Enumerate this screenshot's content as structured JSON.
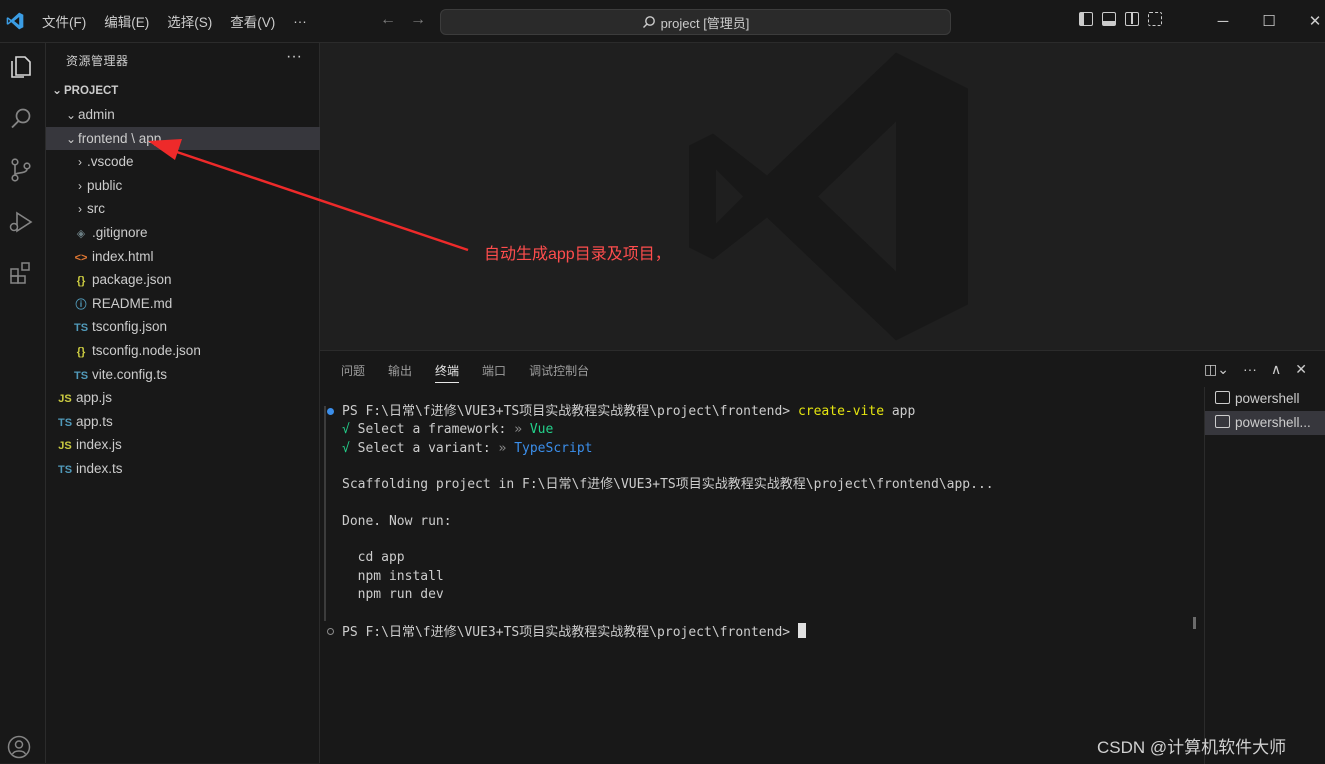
{
  "menu": {
    "items": [
      "文件(F)",
      "编辑(E)",
      "选择(S)",
      "查看(V)",
      "···"
    ]
  },
  "command_center": {
    "text": "project [管理员]"
  },
  "explorer": {
    "title": "资源管理器",
    "more": "···",
    "project_label": "PROJECT",
    "tree": [
      {
        "label": "admin",
        "kind": "folder-open",
        "icon": ""
      },
      {
        "label": "frontend \\ app",
        "kind": "folder-open",
        "icon": ""
      },
      {
        "label": ".vscode",
        "kind": "folder",
        "icon": ""
      },
      {
        "label": "public",
        "kind": "folder",
        "icon": ""
      },
      {
        "label": "src",
        "kind": "folder",
        "icon": ""
      },
      {
        "label": ".gitignore",
        "kind": "file",
        "icon": "◈"
      },
      {
        "label": "index.html",
        "kind": "file",
        "icon": "<>"
      },
      {
        "label": "package.json",
        "kind": "file",
        "icon": "{}"
      },
      {
        "label": "README.md",
        "kind": "file",
        "icon": "ⓘ"
      },
      {
        "label": "tsconfig.json",
        "kind": "file",
        "icon": "TS"
      },
      {
        "label": "tsconfig.node.json",
        "kind": "file",
        "icon": "{}"
      },
      {
        "label": "vite.config.ts",
        "kind": "file",
        "icon": "TS"
      },
      {
        "label": "app.js",
        "kind": "file",
        "icon": "JS"
      },
      {
        "label": "app.ts",
        "kind": "file",
        "icon": "TS"
      },
      {
        "label": "index.js",
        "kind": "file",
        "icon": "JS"
      },
      {
        "label": "index.ts",
        "kind": "file",
        "icon": "TS"
      }
    ]
  },
  "panel": {
    "tabs": [
      "问题",
      "输出",
      "终端",
      "端口",
      "调试控制台"
    ],
    "active_tab": "终端",
    "terminal_lines": {
      "l1_prompt": "PS F:\\日常\\f进修\\VUE3+TS项目实战教程实战教程\\project\\frontend> ",
      "l1_cmd": "create-vite",
      "l1_arg": " app",
      "l2_check": "√ ",
      "l2_text": "Select a framework: ",
      "l2_sep": "» ",
      "l2_val": "Vue",
      "l3_check": "√ ",
      "l3_text": "Select a variant: ",
      "l3_sep": "» ",
      "l3_val": "TypeScript",
      "l4": "Scaffolding project in F:\\日常\\f进修\\VUE3+TS项目实战教程实战教程\\project\\frontend\\app...",
      "l5": "Done. Now run:",
      "l6": "  cd app",
      "l7": "  npm install",
      "l8": "  npm run dev",
      "l9_prompt": "PS F:\\日常\\f进修\\VUE3+TS项目实战教程实战教程\\project\\frontend> "
    },
    "terminals": [
      "powershell",
      "powershell..."
    ]
  },
  "annotation": {
    "text": "自动生成app目录及项目，",
    "color": "#ff4d4d"
  },
  "watermark": "CSDN @计算机软件大师",
  "colors": {
    "accent": "#0078d4",
    "selection": "#37373d",
    "annotation": "#ff4d4d"
  }
}
